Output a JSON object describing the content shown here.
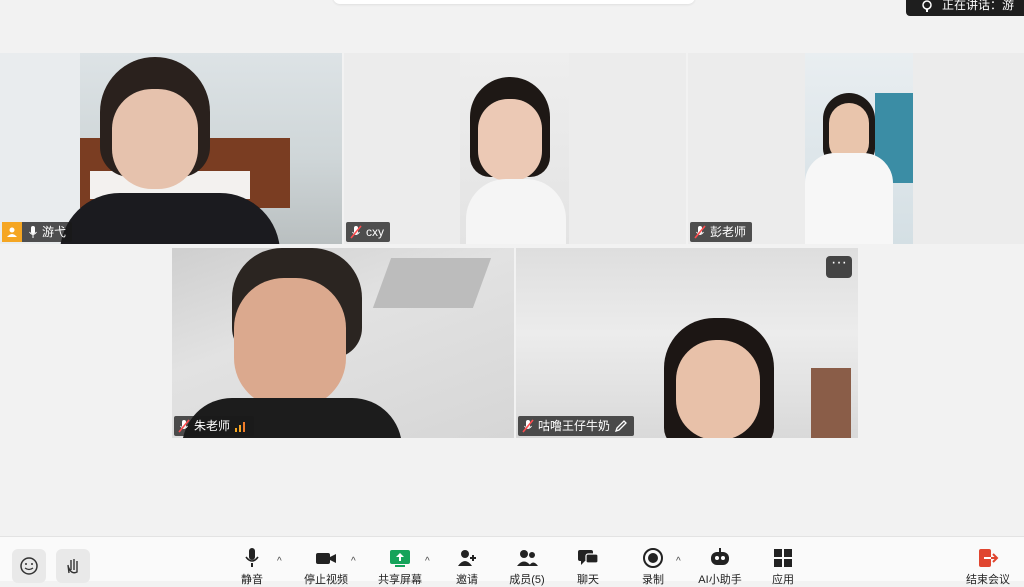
{
  "speaking_banner": {
    "text": "正在讲话：游"
  },
  "participants": [
    {
      "name": "游弋",
      "host": true,
      "active": true
    },
    {
      "name": "cxy"
    },
    {
      "name": "彭老师"
    },
    {
      "name": "朱老师"
    },
    {
      "name": "咕噜王仔牛奶"
    }
  ],
  "toolbar": {
    "mute_label": "静音",
    "video_label": "停止视频",
    "share_label": "共享屏幕",
    "invite_label": "邀请",
    "members_label": "成员(5)",
    "chat_label": "聊天",
    "record_label": "录制",
    "ai_label": "AI小助手",
    "apps_label": "应用",
    "end_label": "结束会议"
  },
  "colors": {
    "active_border": "#3fcf7a",
    "end_red": "#e0452f",
    "share_green": "#15a35a",
    "host_orange": "#f5a623"
  }
}
